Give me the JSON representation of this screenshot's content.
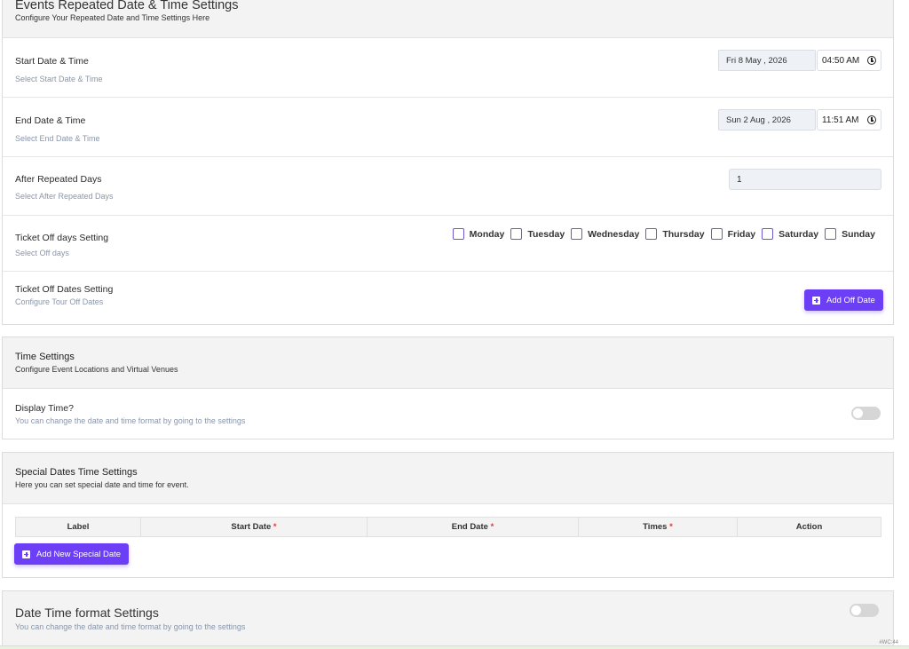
{
  "repeated": {
    "title": "Events Repeated Date & Time Settings",
    "subtitle": "Configure Your Repeated Date and Time Settings Here",
    "start": {
      "title": "Start Date & Time",
      "sub": "Select Start Date & Time",
      "date": "Fri 8 May , 2026",
      "time": "04:50  AM"
    },
    "end": {
      "title": "End Date & Time",
      "sub": "Select End Date & Time",
      "date": "Sun 2 Aug , 2026",
      "time": "11:51  AM"
    },
    "after": {
      "title": "After Repeated Days",
      "sub": "Select After Repeated Days",
      "value": "1"
    },
    "offdays": {
      "title": "Ticket Off days Setting",
      "sub": "Select Off days",
      "days": [
        "Monday",
        "Tuesday",
        "Wednesday",
        "Thursday",
        "Friday",
        "Saturday",
        "Sunday"
      ]
    },
    "offdates": {
      "title": "Ticket Off Dates Setting",
      "sub": "Configure Tour Off Dates",
      "button": "Add Off Date"
    }
  },
  "time_settings": {
    "title": "Time Settings",
    "subtitle": "Configure Event Locations and Virtual Venues",
    "display": {
      "title": "Display Time?",
      "sub": "You can change the date and time format by going to the settings",
      "enabled": false
    }
  },
  "special": {
    "title": "Special Dates Time Settings",
    "subtitle": "Here you can set special date and time for event.",
    "columns": [
      "Label",
      "Start Date",
      "End Date",
      "Times",
      "Action"
    ],
    "required_mark": "*",
    "button": "Add New Special Date"
  },
  "format": {
    "title": "Date Time format Settings",
    "sub": "You can change the date and time format by going to the settings",
    "enabled": false
  },
  "footer_tag": "#WC:44"
}
